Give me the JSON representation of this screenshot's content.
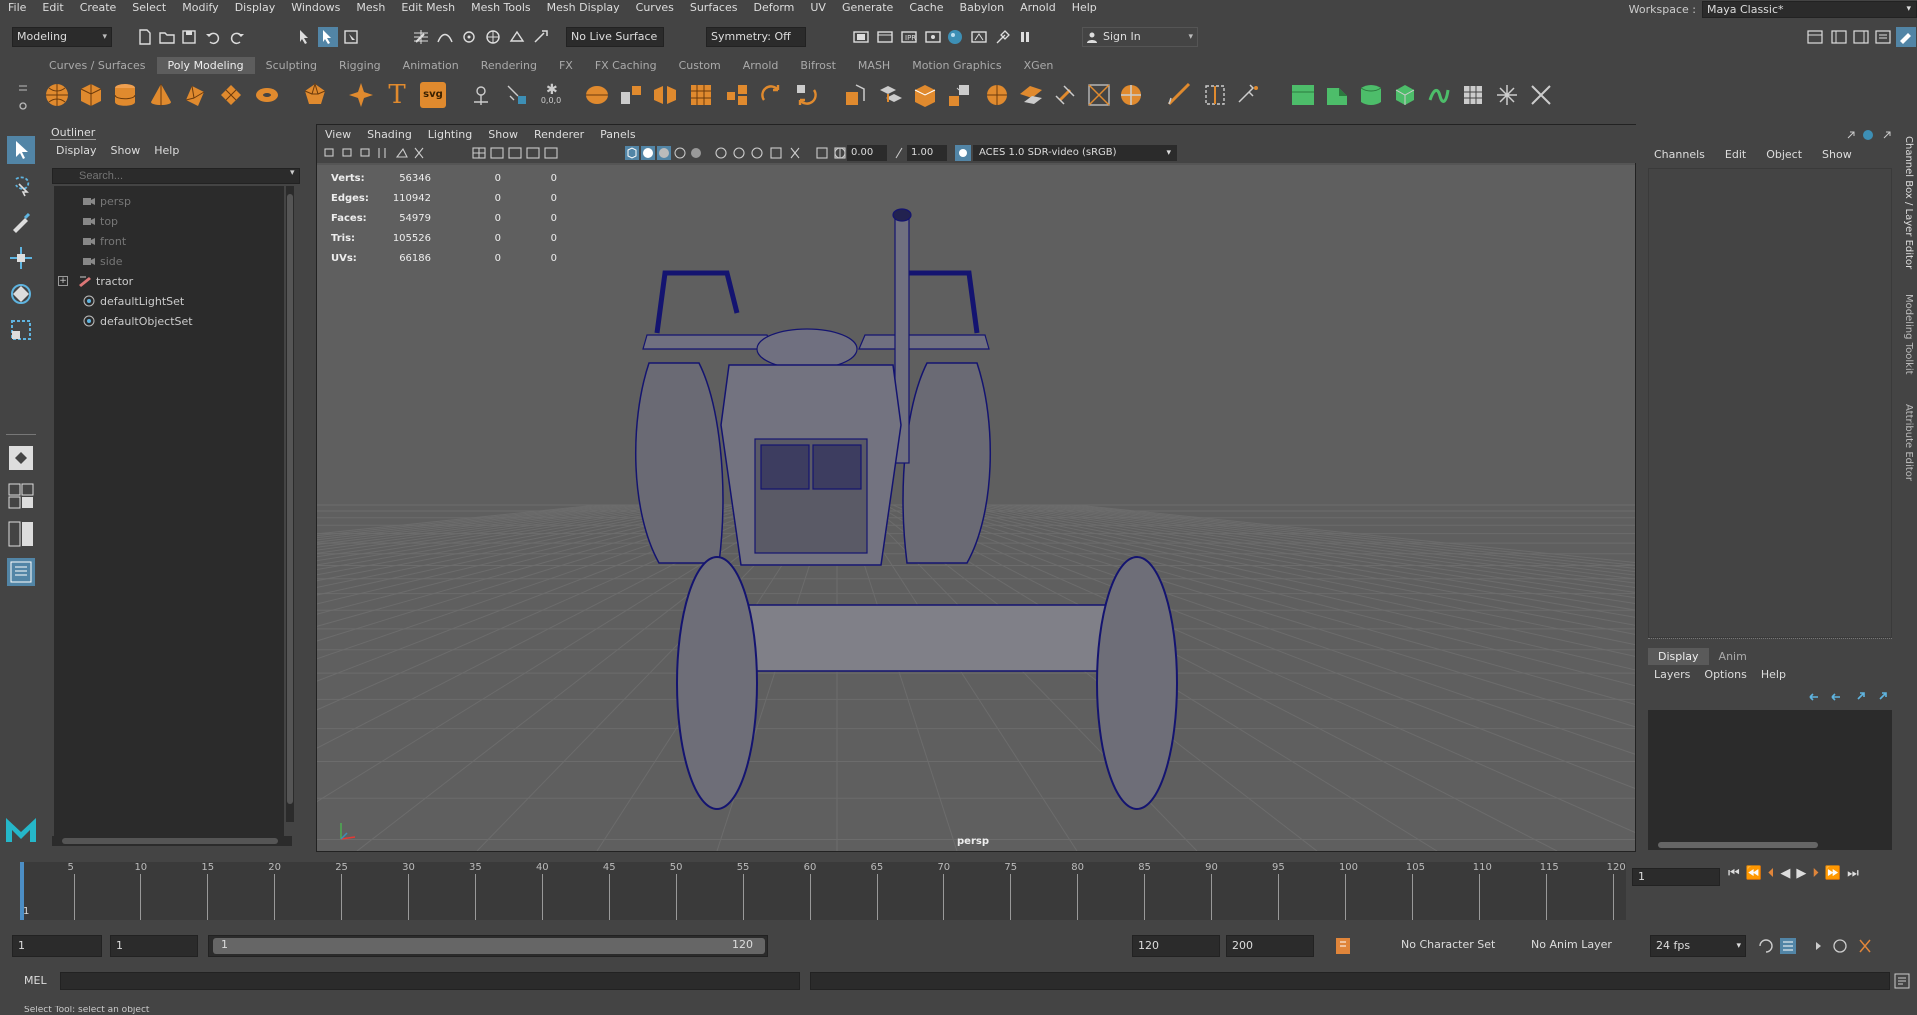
{
  "menubar": {
    "items": [
      "File",
      "Edit",
      "Create",
      "Select",
      "Modify",
      "Display",
      "Windows",
      "Mesh",
      "Edit Mesh",
      "Mesh Tools",
      "Mesh Display",
      "Curves",
      "Surfaces",
      "Deform",
      "UV",
      "Generate",
      "Cache",
      "Babylon",
      "Arnold",
      "Help"
    ],
    "workspace_label": "Workspace :",
    "workspace_value": "Maya Classic*"
  },
  "statusline": {
    "mode": "Modeling",
    "live_surface": "No Live Surface",
    "symmetry": "Symmetry: Off",
    "sign_in": "Sign In"
  },
  "shelf": {
    "tabs": [
      "Curves / Surfaces",
      "Poly Modeling",
      "Sculpting",
      "Rigging",
      "Animation",
      "Rendering",
      "FX",
      "FX Caching",
      "Custom",
      "Arnold",
      "Bifrost",
      "MASH",
      "Motion Graphics",
      "XGen"
    ],
    "active": "Poly Modeling",
    "text_icons": {
      "type": "T",
      "svg": "svg",
      "coords": "0,0,0"
    }
  },
  "outliner": {
    "title": "Outliner",
    "menus": [
      "Display",
      "Show",
      "Help"
    ],
    "search_placeholder": "Search...",
    "items": [
      {
        "name": "persp",
        "dim": true,
        "icon": "camera-icon"
      },
      {
        "name": "top",
        "dim": true,
        "icon": "camera-icon"
      },
      {
        "name": "front",
        "dim": true,
        "icon": "camera-icon"
      },
      {
        "name": "side",
        "dim": true,
        "icon": "camera-icon"
      },
      {
        "name": "tractor",
        "dim": false,
        "icon": "group-icon",
        "expandable": true
      },
      {
        "name": "defaultLightSet",
        "dim": false,
        "icon": "set-icon"
      },
      {
        "name": "defaultObjectSet",
        "dim": false,
        "icon": "set-icon"
      }
    ]
  },
  "viewport": {
    "menus": [
      "View",
      "Shading",
      "Lighting",
      "Show",
      "Renderer",
      "Panels"
    ],
    "exposure": "0.00",
    "gamma": "1.00",
    "color_space": "ACES 1.0 SDR-video (sRGB)",
    "camera": "persp",
    "hud": [
      {
        "label": "Verts:",
        "v1": "56346",
        "v2": "0",
        "v3": "0"
      },
      {
        "label": "Edges:",
        "v1": "110942",
        "v2": "0",
        "v3": "0"
      },
      {
        "label": "Faces:",
        "v1": "54979",
        "v2": "0",
        "v3": "0"
      },
      {
        "label": "Tris:",
        "v1": "105526",
        "v2": "0",
        "v3": "0"
      },
      {
        "label": "UVs:",
        "v1": "66186",
        "v2": "0",
        "v3": "0"
      }
    ],
    "wire_color": "#1a1a8c"
  },
  "channelbox": {
    "menus": [
      "Channels",
      "Edit",
      "Object",
      "Show"
    ],
    "layer_tabs": [
      "Display",
      "Anim"
    ],
    "layer_menus": [
      "Layers",
      "Options",
      "Help"
    ],
    "side_tabs": [
      "Channel Box / Layer Editor",
      "Modeling Toolkit",
      "Attribute Editor"
    ]
  },
  "timeline": {
    "ticks": [
      "5",
      "10",
      "15",
      "20",
      "25",
      "30",
      "35",
      "40",
      "45",
      "50",
      "55",
      "60",
      "65",
      "70",
      "75",
      "80",
      "85",
      "90",
      "95",
      "100",
      "105",
      "110",
      "115",
      "120"
    ],
    "current_frame_marker": "1",
    "current_frame": "1"
  },
  "range": {
    "start": "1",
    "anim_start": "1",
    "range_start": "1",
    "range_end": "120",
    "end": "120",
    "anim_end": "200",
    "character_set": "No Character Set",
    "anim_layer": "No Anim Layer",
    "fps": "24 fps"
  },
  "commandline": {
    "label": "MEL"
  },
  "helpline": {
    "text": "Select Tool: select an object"
  },
  "colors": {
    "accent": "#5285a6",
    "panel": "#444444",
    "field": "#2b2b2b",
    "viewport_bg": "#5f5f5f"
  }
}
